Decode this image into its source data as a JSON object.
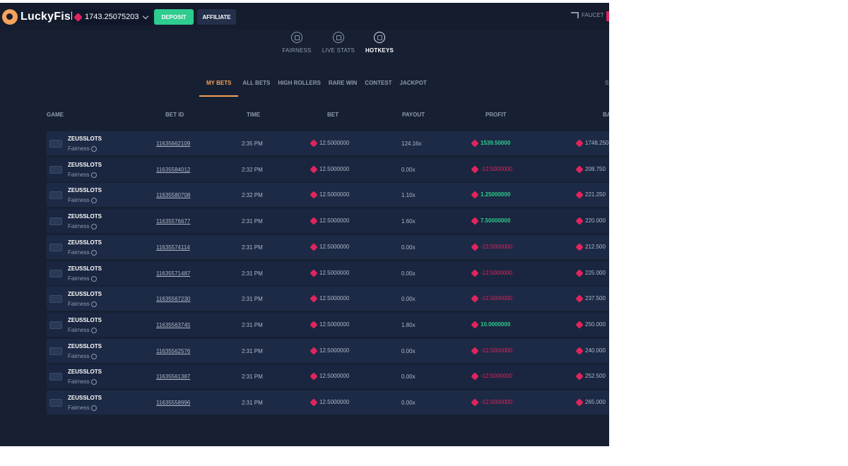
{
  "app": {
    "logo_text": "LuckyFish",
    "balance": "1743.25075203 TI",
    "deposit_label": "DEPOSIT",
    "affiliate_label": "AFFILIATE",
    "faucet_label": "FAUCET",
    "brand_color": "#f5a25d",
    "accent_color": "#2ecc8f",
    "currency_color": "#e0245e"
  },
  "subnav": [
    {
      "label": "FAIRNESS",
      "icon": "fairness-icon"
    },
    {
      "label": "LIVE STATS",
      "icon": "live-stats-icon"
    },
    {
      "label": "HOTKEYS",
      "icon": "hotkeys-icon",
      "active": true
    }
  ],
  "tabs": [
    {
      "label": "MY BETS",
      "active": true
    },
    {
      "label": "ALL BETS"
    },
    {
      "label": "HIGH ROLLERS"
    },
    {
      "label": "RARE WIN"
    },
    {
      "label": "CONTEST"
    },
    {
      "label": "JACKPOT"
    }
  ],
  "tab_edge": "S",
  "table": {
    "columns": [
      "GAME",
      "BET ID",
      "TIME",
      "BET",
      "PAYOUT",
      "PROFIT",
      "BA"
    ],
    "rows": [
      {
        "game": "ZEUSSLOTS",
        "fair": "Fairness",
        "bet_id": "11635662109",
        "time": "2:35 PM",
        "bet": "12.5000000",
        "payout": "124.16x",
        "profit": "1539.50000",
        "positive": true,
        "balance": "1748.250"
      },
      {
        "game": "ZEUSSLOTS",
        "fair": "Fairness",
        "bet_id": "11635584012",
        "time": "2:32 PM",
        "bet": "12.5000000",
        "payout": "0.00x",
        "profit": "-12.5000000",
        "positive": false,
        "balance": "208.750"
      },
      {
        "game": "ZEUSSLOTS",
        "fair": "Fairness",
        "bet_id": "11635580708",
        "time": "2:32 PM",
        "bet": "12.5000000",
        "payout": "1.10x",
        "profit": "1.25000000",
        "positive": true,
        "balance": "221.250"
      },
      {
        "game": "ZEUSSLOTS",
        "fair": "Fairness",
        "bet_id": "11635576677",
        "time": "2:31 PM",
        "bet": "12.5000000",
        "payout": "1.60x",
        "profit": "7.50000000",
        "positive": true,
        "balance": "220.000"
      },
      {
        "game": "ZEUSSLOTS",
        "fair": "Fairness",
        "bet_id": "11635574114",
        "time": "2:31 PM",
        "bet": "12.5000000",
        "payout": "0.00x",
        "profit": "-12.5000000",
        "positive": false,
        "balance": "212.500"
      },
      {
        "game": "ZEUSSLOTS",
        "fair": "Fairness",
        "bet_id": "11635571487",
        "time": "2:31 PM",
        "bet": "12.5000000",
        "payout": "0.00x",
        "profit": "-12.5000000",
        "positive": false,
        "balance": "225.000"
      },
      {
        "game": "ZEUSSLOTS",
        "fair": "Fairness",
        "bet_id": "11635567230",
        "time": "2:31 PM",
        "bet": "12.5000000",
        "payout": "0.00x",
        "profit": "-12.5000000",
        "positive": false,
        "balance": "237.500"
      },
      {
        "game": "ZEUSSLOTS",
        "fair": "Fairness",
        "bet_id": "11635563745",
        "time": "2:31 PM",
        "bet": "12.5000000",
        "payout": "1.80x",
        "profit": "10.0000000",
        "positive": true,
        "balance": "250.000"
      },
      {
        "game": "ZEUSSLOTS",
        "fair": "Fairness",
        "bet_id": "11635562576",
        "time": "2:31 PM",
        "bet": "12.5000000",
        "payout": "0.00x",
        "profit": "-12.5000000",
        "positive": false,
        "balance": "240.000"
      },
      {
        "game": "ZEUSSLOTS",
        "fair": "Fairness",
        "bet_id": "11635561387",
        "time": "2:31 PM",
        "bet": "12.5000000",
        "payout": "0.00x",
        "profit": "-12.5000000",
        "positive": false,
        "balance": "252.500"
      },
      {
        "game": "ZEUSSLOTS",
        "fair": "Fairness",
        "bet_id": "11635558996",
        "time": "2:31 PM",
        "bet": "12.5000000",
        "payout": "0.00x",
        "profit": "-12.5000000",
        "positive": false,
        "balance": "265.000"
      }
    ]
  },
  "taskbar": [
    {
      "icon": "windows-start-icon"
    },
    {
      "icon": "search-icon"
    },
    {
      "icon": "mail-icon"
    },
    {
      "icon": "edge-browser-icon"
    },
    {
      "icon": "file-explorer-icon"
    },
    {
      "icon": "store-icon"
    },
    {
      "icon": "brave-browser-icon",
      "active": true
    },
    {
      "icon": "app-a-icon"
    },
    {
      "icon": "chrome-icon"
    }
  ]
}
